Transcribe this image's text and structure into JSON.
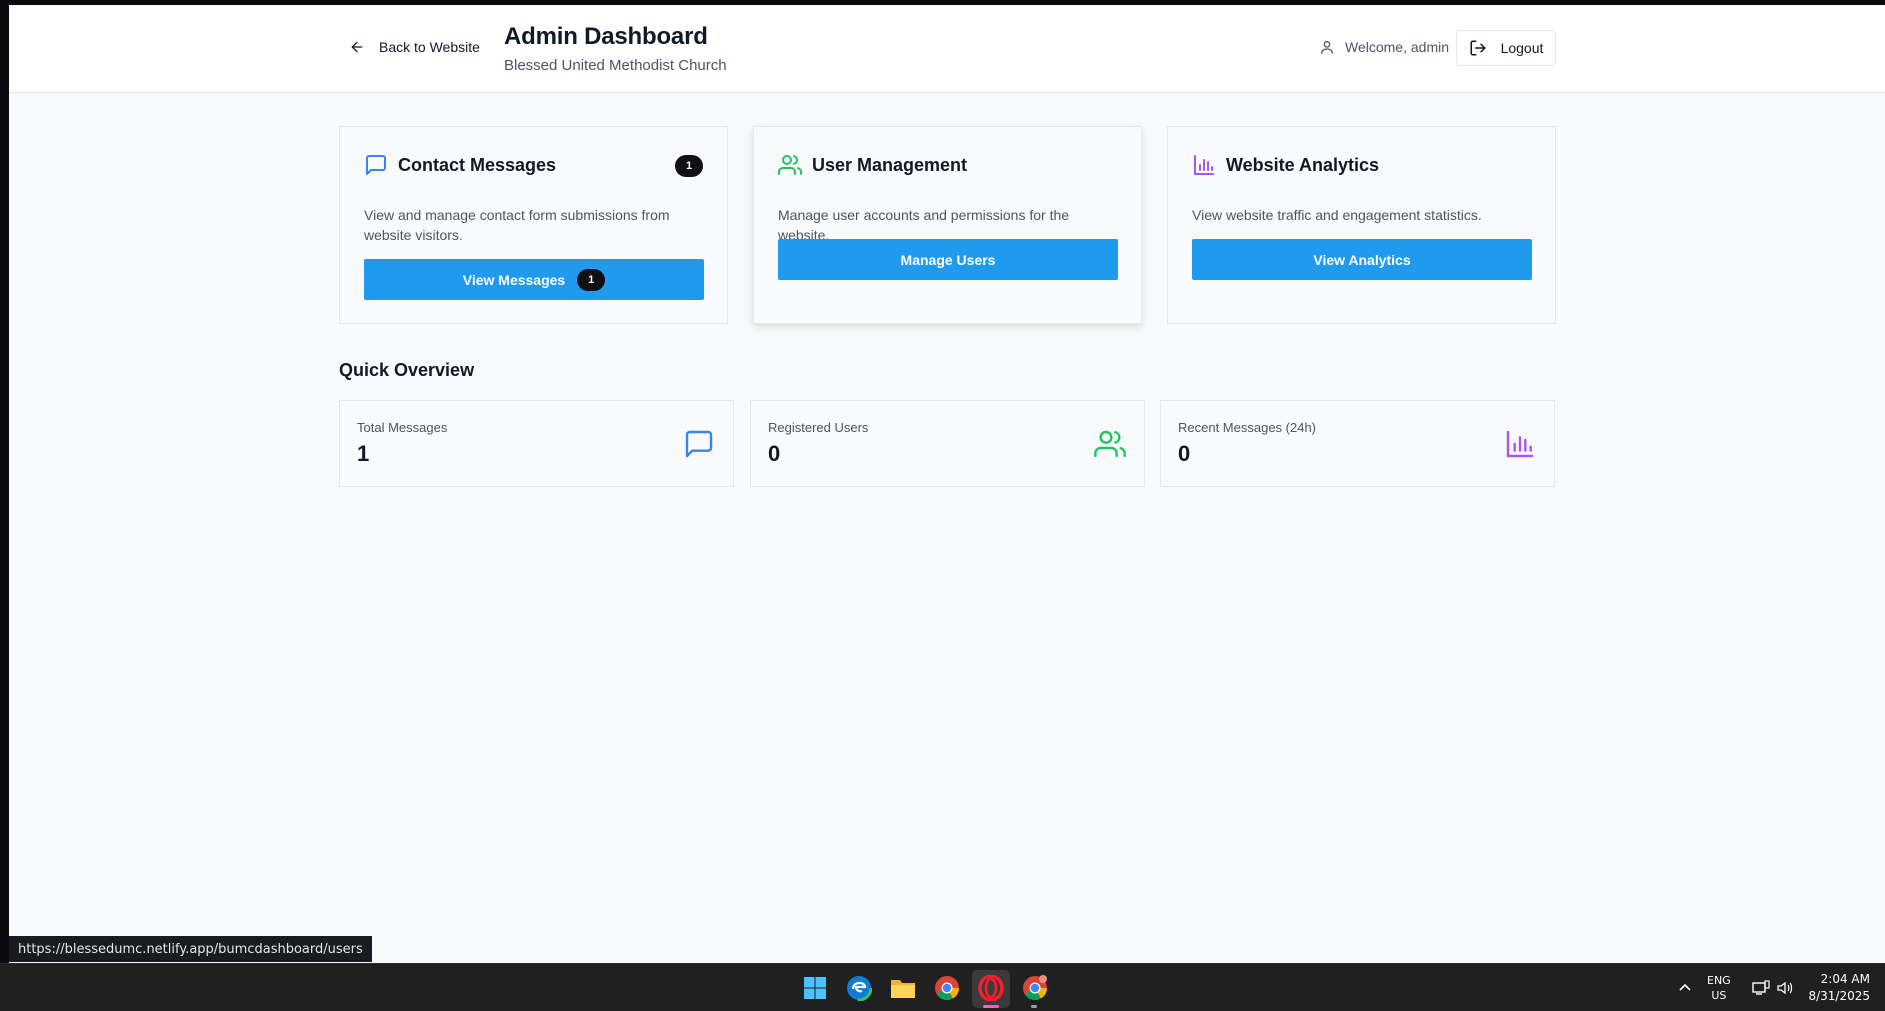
{
  "header": {
    "back_label": "Back to Website",
    "title": "Admin Dashboard",
    "subtitle": "Blessed United Methodist Church",
    "welcome": "Welcome, admin",
    "logout_label": "Logout"
  },
  "cards": [
    {
      "title": "Contact Messages",
      "icon": "message-square-icon",
      "badge": "1",
      "description": "View and manage contact form submissions from website visitors.",
      "button_label": "View Messages",
      "button_badge": "1"
    },
    {
      "title": "User Management",
      "icon": "users-icon",
      "description": "Manage user accounts and permissions for the website.",
      "button_label": "Manage Users"
    },
    {
      "title": "Website Analytics",
      "icon": "bar-chart-icon",
      "description": "View website traffic and engagement statistics.",
      "button_label": "View Analytics"
    }
  ],
  "overview": {
    "title": "Quick Overview",
    "stats": [
      {
        "label": "Total Messages",
        "value": "1",
        "icon": "message-square-icon"
      },
      {
        "label": "Registered Users",
        "value": "0",
        "icon": "users-icon"
      },
      {
        "label": "Recent Messages (24h)",
        "value": "0",
        "icon": "bar-chart-icon"
      }
    ]
  },
  "status_url": "https://blessedumc.netlify.app/bumcdashboard/users",
  "taskbar": {
    "lang_line1": "ENG",
    "lang_line2": "US",
    "time": "2:04 AM",
    "date": "8/31/2025"
  },
  "colors": {
    "primary_button": "#1e9bef",
    "blue_icon": "#3b82f6",
    "green_icon": "#22c55e",
    "purple_icon": "#a855f7",
    "badge": "#0f0f14"
  }
}
